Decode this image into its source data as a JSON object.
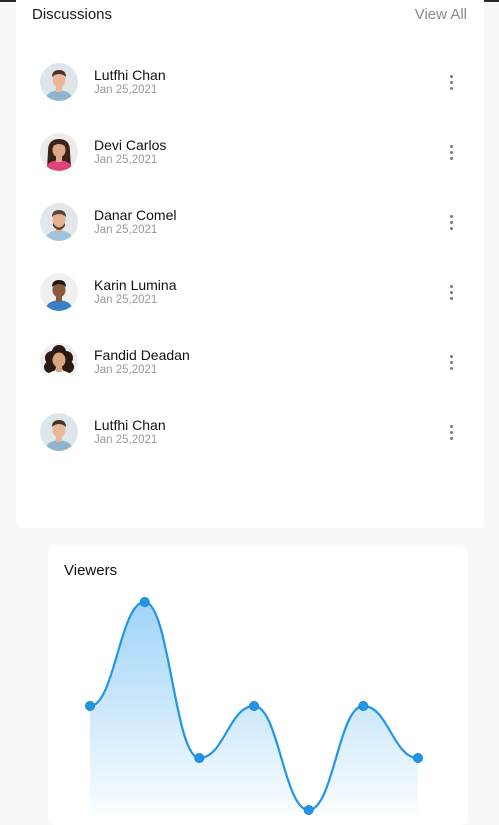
{
  "discussions": {
    "title": "Discussions",
    "view_all": "View All",
    "items": [
      {
        "name": "Lutfhi Chan",
        "date": "Jan 25,2021",
        "avatar": "man-short-hair-avatar"
      },
      {
        "name": "Devi Carlos",
        "date": "Jan 25,2021",
        "avatar": "woman-long-hair-avatar"
      },
      {
        "name": "Danar Comel",
        "date": "Jan 25,2021",
        "avatar": "man-beard-glasses-avatar"
      },
      {
        "name": "Karin Lumina",
        "date": "Jan 25,2021",
        "avatar": "man-smiling-avatar"
      },
      {
        "name": "Fandid Deadan",
        "date": "Jan 25,2021",
        "avatar": "woman-curly-hair-avatar"
      },
      {
        "name": "Lutfhi Chan",
        "date": "Jan 25,2021",
        "avatar": "man-short-hair-avatar"
      }
    ],
    "menu_icon": "more-vertical-icon"
  },
  "viewers": {
    "title": "Viewers"
  },
  "chart_data": {
    "type": "area",
    "title": "Viewers",
    "x": [
      1,
      2,
      3,
      4,
      5,
      6,
      7
    ],
    "values": [
      3,
      5,
      2,
      3,
      1,
      3,
      2
    ],
    "ylim": [
      1,
      5
    ],
    "grid": false,
    "line_color": "#2196e8",
    "point_color": "#2196e8",
    "fill_top_color": "#9fd4f8",
    "fill_bottom_color": "#ffffff"
  },
  "colors": {
    "background": "#f5f9fc",
    "card": "#ffffff",
    "text_primary": "#111111",
    "text_secondary": "#9a9a9a",
    "accent": "#2196e8"
  }
}
